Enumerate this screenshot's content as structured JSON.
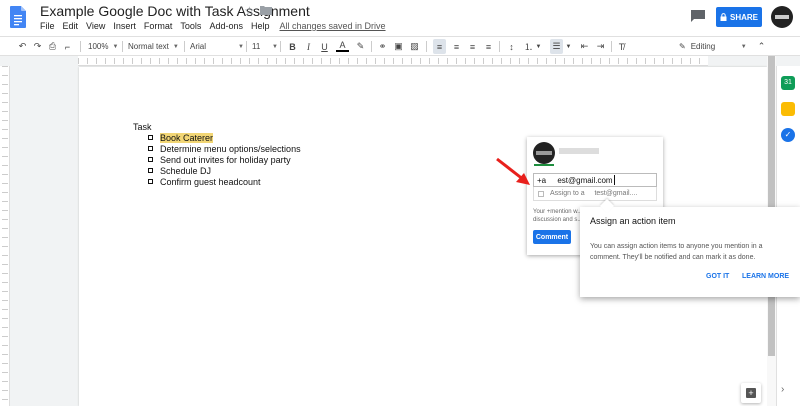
{
  "app": {
    "title": "Example Google Doc with Task Assignment",
    "save_status": "All changes saved in Drive"
  },
  "menu": [
    "File",
    "Edit",
    "View",
    "Insert",
    "Format",
    "Tools",
    "Add-ons",
    "Help"
  ],
  "header": {
    "share_label": "SHARE"
  },
  "toolbar": {
    "zoom": "100%",
    "style": "Normal text",
    "font": "Arial",
    "size": "11",
    "mode": "Editing"
  },
  "document": {
    "heading": "Task",
    "tasks": [
      {
        "label": "Book Caterer",
        "highlighted": true
      },
      {
        "label": "Determine menu options/selections",
        "highlighted": false
      },
      {
        "label": "Send out invites for holiday party",
        "highlighted": false
      },
      {
        "label": "Schedule DJ",
        "highlighted": false
      },
      {
        "label": "Confirm guest headcount",
        "highlighted": false
      }
    ]
  },
  "comment": {
    "input_value": "+a       est@gmail.com",
    "assign_label": "Assign to a       test@gmail....",
    "hint": "Your +mention w... discussion and s...",
    "button_label": "Comment"
  },
  "tooltip": {
    "title": "Assign an action item",
    "body": "You can assign action items to anyone you mention in a comment. They'll be notified and can mark it as done.",
    "got_it": "GOT IT",
    "learn_more": "LEARN MORE"
  },
  "colors": {
    "accent": "#1a73e8",
    "highlight": "#f2d675",
    "arrow": "#e8201c",
    "sheets": "#f4b400",
    "keep": "#fbbc04",
    "tasks": "#1a73e8"
  }
}
